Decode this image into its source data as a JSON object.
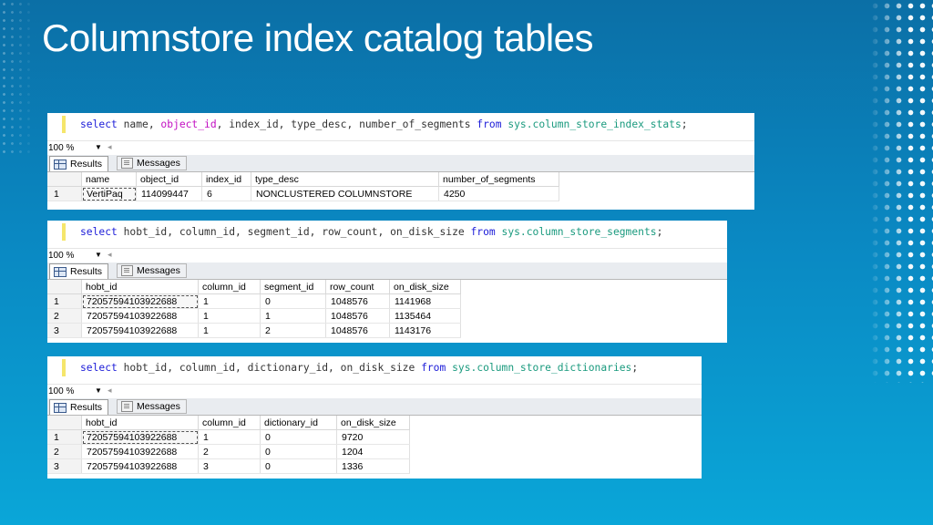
{
  "title": "Columnstore index catalog tables",
  "colors": {
    "background": "#0a88c2",
    "keyword": "#1b1bd8",
    "object": "#1a9a7e",
    "function": "#c20fc2"
  },
  "panels": [
    {
      "query": [
        {
          "t": "select",
          "c": "kw"
        },
        {
          "t": " name, ",
          "c": ""
        },
        {
          "t": "object_id",
          "c": "fn"
        },
        {
          "t": ", index_id, type_desc, number_of_segments ",
          "c": ""
        },
        {
          "t": "from",
          "c": "kw"
        },
        {
          "t": " ",
          "c": ""
        },
        {
          "t": "sys.column_store_index_stats",
          "c": "obj"
        },
        {
          "t": ";",
          "c": ""
        }
      ],
      "zoom": "100 %",
      "tabs": {
        "results": "Results",
        "messages": "Messages"
      },
      "columns": [
        "name",
        "object_id",
        "index_id",
        "type_desc",
        "number_of_segments"
      ],
      "widths": [
        60,
        72,
        54,
        206,
        132
      ],
      "rows": [
        [
          "1",
          "VertiPaq",
          "114099447",
          "6",
          "NONCLUSTERED COLUMNSTORE",
          "4250"
        ]
      ]
    },
    {
      "query": [
        {
          "t": "select",
          "c": "kw"
        },
        {
          "t": " hobt_id, column_id, segment_id, row_count, on_disk_size ",
          "c": ""
        },
        {
          "t": "from",
          "c": "kw"
        },
        {
          "t": " ",
          "c": ""
        },
        {
          "t": "sys.column_store_segments",
          "c": "obj"
        },
        {
          "t": ";",
          "c": ""
        }
      ],
      "zoom": "100 %",
      "tabs": {
        "results": "Results",
        "messages": "Messages"
      },
      "columns": [
        "hobt_id",
        "column_id",
        "segment_id",
        "row_count",
        "on_disk_size"
      ],
      "widths": [
        128,
        68,
        72,
        70,
        78
      ],
      "rows": [
        [
          "1",
          "72057594103922688",
          "1",
          "0",
          "1048576",
          "1141968"
        ],
        [
          "2",
          "72057594103922688",
          "1",
          "1",
          "1048576",
          "1135464"
        ],
        [
          "3",
          "72057594103922688",
          "1",
          "2",
          "1048576",
          "1143176"
        ]
      ]
    },
    {
      "query": [
        {
          "t": "select",
          "c": "kw"
        },
        {
          "t": " hobt_id, column_id, dictionary_id, on_disk_size ",
          "c": ""
        },
        {
          "t": "from",
          "c": "kw"
        },
        {
          "t": " ",
          "c": ""
        },
        {
          "t": "sys.column_store_dictionaries",
          "c": "obj"
        },
        {
          "t": ";",
          "c": ""
        }
      ],
      "zoom": "100 %",
      "tabs": {
        "results": "Results",
        "messages": "Messages"
      },
      "columns": [
        "hobt_id",
        "column_id",
        "dictionary_id",
        "on_disk_size"
      ],
      "widths": [
        128,
        68,
        84,
        80
      ],
      "rows": [
        [
          "1",
          "72057594103922688",
          "1",
          "0",
          "9720"
        ],
        [
          "2",
          "72057594103922688",
          "2",
          "0",
          "1204"
        ],
        [
          "3",
          "72057594103922688",
          "3",
          "0",
          "1336"
        ]
      ]
    }
  ]
}
